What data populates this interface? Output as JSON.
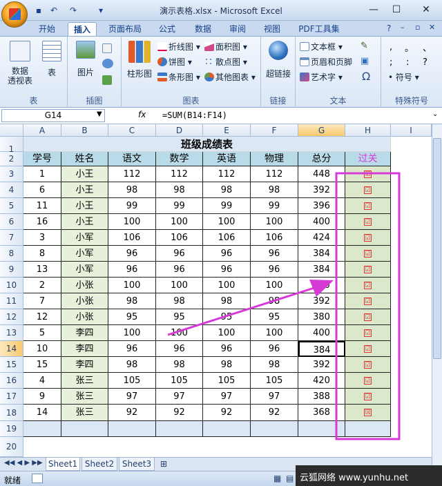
{
  "window": {
    "title": "演示表格.xlsx - Microsoft Excel"
  },
  "tabs": [
    "开始",
    "插入",
    "页面布局",
    "公式",
    "数据",
    "审阅",
    "视图",
    "PDF工具集"
  ],
  "active_tab": "插入",
  "ribbon": {
    "groups": {
      "table": "表",
      "illustrations": "插图",
      "charts": "图表",
      "links": "链接",
      "text": "文本",
      "special": "特殊符号"
    },
    "pivot": "数据\n透视表",
    "table_btn": "表",
    "picture": "图片",
    "bar_chart": "柱形图",
    "line": "折线图",
    "pie": "饼图",
    "barh": "条形图",
    "area": "面积图",
    "scatter": "散点图",
    "other_charts": "其他图表",
    "hyperlink": "超链接",
    "textbox": "文本框",
    "header_footer": "页眉和页脚",
    "wordart": "艺术字",
    "omega": "Ω",
    "symbols": "符号"
  },
  "formula_bar": {
    "name_box": "G14",
    "fx": "fx",
    "formula": "=SUM(B14:F14)"
  },
  "columns": [
    "A",
    "B",
    "C",
    "D",
    "E",
    "F",
    "G",
    "H",
    "I"
  ],
  "rows": [
    "1",
    "2",
    "3",
    "4",
    "5",
    "6",
    "7",
    "8",
    "9",
    "10",
    "11",
    "12",
    "13",
    "14",
    "15",
    "16",
    "17",
    "18",
    "19",
    "20"
  ],
  "sheet": {
    "title": "班级成绩表",
    "headers": [
      "学号",
      "姓名",
      "语文",
      "数学",
      "英语",
      "物理",
      "总分",
      "过关"
    ],
    "data": [
      [
        "1",
        "小王",
        "112",
        "112",
        "112",
        "112",
        "448",
        "☑"
      ],
      [
        "6",
        "小王",
        "98",
        "98",
        "98",
        "98",
        "392",
        "☑"
      ],
      [
        "11",
        "小王",
        "99",
        "99",
        "99",
        "99",
        "396",
        "☑"
      ],
      [
        "16",
        "小王",
        "100",
        "100",
        "100",
        "100",
        "400",
        "☑"
      ],
      [
        "3",
        "小军",
        "106",
        "106",
        "106",
        "106",
        "424",
        "☑"
      ],
      [
        "8",
        "小军",
        "96",
        "96",
        "96",
        "96",
        "384",
        "☑"
      ],
      [
        "13",
        "小军",
        "96",
        "96",
        "96",
        "96",
        "384",
        "☑"
      ],
      [
        "2",
        "小张",
        "100",
        "100",
        "100",
        "100",
        "400",
        "☑"
      ],
      [
        "7",
        "小张",
        "98",
        "98",
        "98",
        "98",
        "392",
        "☑"
      ],
      [
        "12",
        "小张",
        "95",
        "95",
        "95",
        "95",
        "380",
        "☑"
      ],
      [
        "5",
        "李四",
        "100",
        "100",
        "100",
        "100",
        "400",
        "☑"
      ],
      [
        "10",
        "李四",
        "96",
        "96",
        "96",
        "96",
        "384",
        "☑"
      ],
      [
        "15",
        "李四",
        "98",
        "98",
        "98",
        "98",
        "392",
        "☑"
      ],
      [
        "4",
        "张三",
        "105",
        "105",
        "105",
        "105",
        "420",
        "☑"
      ],
      [
        "9",
        "张三",
        "97",
        "97",
        "97",
        "97",
        "388",
        "☑"
      ],
      [
        "14",
        "张三",
        "92",
        "92",
        "92",
        "92",
        "368",
        "☒"
      ]
    ]
  },
  "sheet_tabs": [
    "Sheet1",
    "Sheet2",
    "Sheet3"
  ],
  "status": {
    "ready": "就绪"
  },
  "watermark": {
    "text": "云狐网络 www.yunhu.net"
  },
  "colors": {
    "header_fill": "#b9dbe9",
    "name_fill": "#e6f0da",
    "pass_fill": "#dbe8cc",
    "highlight": "#d63ad6"
  }
}
